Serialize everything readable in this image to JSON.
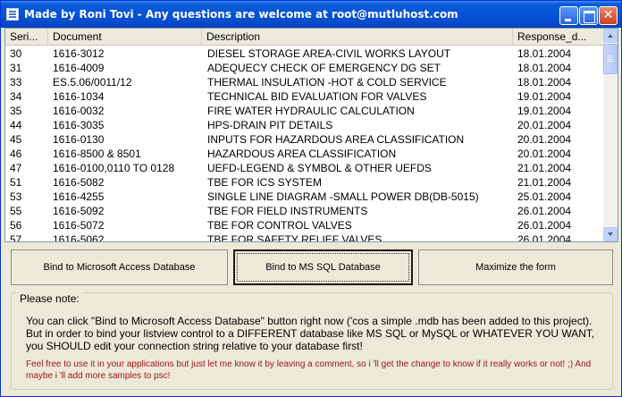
{
  "window": {
    "title": "Made by Roni Tovi - Any questions are welcome at root@mutluhost.com"
  },
  "listview": {
    "columns": [
      "Seri...",
      "Document",
      "Description",
      "Response_d..."
    ],
    "rows": [
      [
        "30",
        "1616-3012",
        "DIESEL STORAGE AREA-CIVIL WORKS LAYOUT",
        "18.01.2004"
      ],
      [
        "31",
        "1616-4009",
        "ADEQUECY CHECK OF EMERGENCY DG SET",
        "18.01.2004"
      ],
      [
        "33",
        "ES.5.06/0011/12",
        "THERMAL INSULATION -HOT & COLD SERVICE",
        "18.01.2004"
      ],
      [
        "34",
        "1616-1034",
        "TECHNICAL BID EVALUATION FOR VALVES",
        "19.01.2004"
      ],
      [
        "35",
        "1616-0032",
        "FIRE WATER HYDRAULIC CALCULATION",
        "19.01.2004"
      ],
      [
        "44",
        "1616-3035",
        "HPS-DRAIN PIT DETAILS",
        "20.01.2004"
      ],
      [
        "45",
        "1616-0130",
        "INPUTS FOR HAZARDOUS AREA CLASSIFICATION",
        "20.01.2004"
      ],
      [
        "46",
        "1616-8500 & 8501",
        "HAZARDOUS AREA CLASSIFICATION",
        "20.01.2004"
      ],
      [
        "47",
        "1616-0100,0110 TO 0128",
        "UEFD-LEGEND & SYMBOL & OTHER UEFDS",
        "21.01.2004"
      ],
      [
        "51",
        "1616-5082",
        "TBE FOR ICS SYSTEM",
        "21.01.2004"
      ],
      [
        "53",
        "1616-4255",
        "SINGLE LINE DIAGRAM -SMALL POWER DB(DB-5015)",
        "25.01.2004"
      ],
      [
        "55",
        "1616-5092",
        "TBE FOR FIELD INSTRUMENTS",
        "26.01.2004"
      ],
      [
        "56",
        "1616-5072",
        "TBE FOR CONTROL VALVES",
        "26.01.2004"
      ],
      [
        "57",
        "1616-5062",
        "TBE FOR SAFETY RELIEF VALVES",
        "26.01.2004"
      ]
    ]
  },
  "buttons": {
    "access": "Bind to Microsoft Access Database",
    "sql": "Bind to MS SQL Database",
    "maximize": "Maximize the form"
  },
  "note": {
    "legend": "Please note:",
    "text": "You can click \"Bind to Microsoft Access Database\"  button right now ('cos a simple .mdb has been added to this project). But in order to bind your listview control to a DIFFERENT database like MS SQL or MySQL or WHATEVER YOU WANT, you SHOULD edit your connection string relative to your database first!",
    "footer": "Feel free to use it in your applications but just let me know it by leaving a comment, so i 'll get the change to know if it really works or not! ;) And maybe i 'll add more samples to psc!"
  },
  "colors": {
    "titlebar": "#0654d6",
    "window_bg": "#ece9d8",
    "note_footer": "#a01818"
  }
}
